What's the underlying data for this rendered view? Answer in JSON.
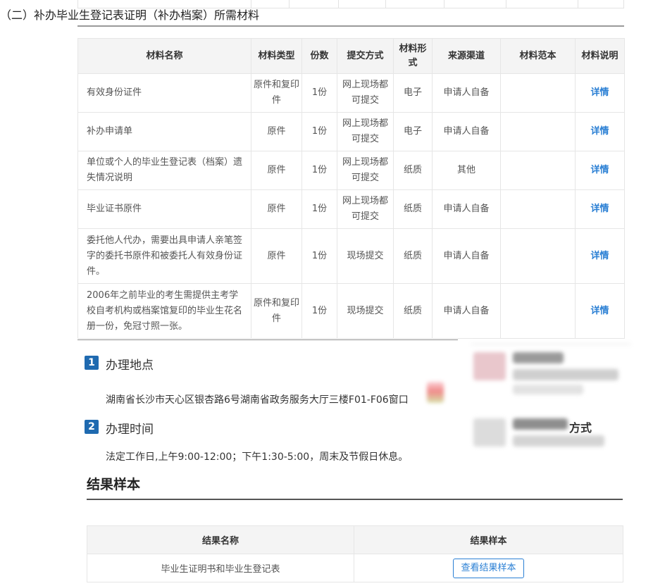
{
  "section_title": "（二）补办毕业生登记表证明（补办档案）所需材料",
  "materials": {
    "headers": [
      "材料名称",
      "材料类型",
      "份数",
      "提交方式",
      "材料形式",
      "来源渠道",
      "材料范本",
      "材料说明"
    ],
    "rows": [
      {
        "name": "有效身份证件",
        "type": "原件和复印件",
        "count": "1份",
        "submit": "网上现场都可提交",
        "form": "电子",
        "source": "申请人自备",
        "sample": "",
        "detail": "详情"
      },
      {
        "name": "补办申请单",
        "type": "原件",
        "count": "1份",
        "submit": "网上现场都可提交",
        "form": "电子",
        "source": "申请人自备",
        "sample": "",
        "detail": "详情"
      },
      {
        "name": "单位或个人的毕业生登记表（档案）遗失情况说明",
        "type": "原件",
        "count": "1份",
        "submit": "网上现场都可提交",
        "form": "纸质",
        "source": "其他",
        "sample": "",
        "detail": "详情"
      },
      {
        "name": "毕业证书原件",
        "type": "原件",
        "count": "1份",
        "submit": "网上现场都可提交",
        "form": "纸质",
        "source": "申请人自备",
        "sample": "",
        "detail": "详情"
      },
      {
        "name": "委托他人代办，需要出具申请人亲笔签字的委托书原件和被委托人有效身份证件。",
        "type": "原件",
        "count": "1份",
        "submit": "现场提交",
        "form": "纸质",
        "source": "申请人自备",
        "sample": "",
        "detail": "详情"
      },
      {
        "name": "2006年之前毕业的考生需提供主考学校自考机构或档案馆复印的毕业生花名册一份，免冠寸照一张。",
        "type": "原件和复印件",
        "count": "1份",
        "submit": "现场提交",
        "form": "纸质",
        "source": "申请人自备",
        "sample": "",
        "detail": "详情"
      }
    ]
  },
  "place": {
    "number": "1",
    "heading": "办理地点",
    "text": "湖南省长沙市天心区银杏路6号湖南省政务服务大厅三楼F01-F06窗口"
  },
  "time": {
    "number": "2",
    "heading": "办理时间",
    "text": "法定工作日,上午9:00-12:00；下午1:30-5:00，周末及节假日休息。"
  },
  "blurred": {
    "partial_text": "方式"
  },
  "result": {
    "heading": "结果样本",
    "headers": [
      "结果名称",
      "结果样本"
    ],
    "row": {
      "name": "毕业生证明书和毕业生登记表",
      "button": "查看结果样本"
    }
  }
}
